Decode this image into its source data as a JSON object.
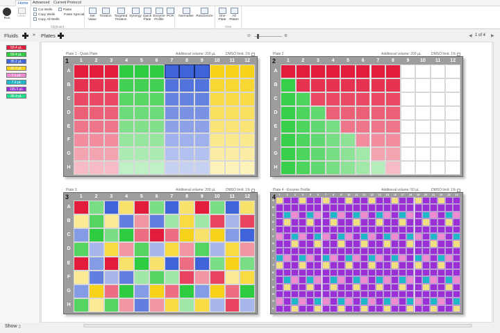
{
  "tabs": [
    "Home",
    "Advanced",
    "Current Protocol"
  ],
  "ribbon": {
    "run": "Run",
    "undo": "Undo",
    "clipboard": {
      "cut": "Cut Wells",
      "copy": "Copy Wells",
      "copy_all": "Copy All Wells",
      "paste": "Paste",
      "paste_special": "Paste Special",
      "label": "Clipboard"
    },
    "tools": [
      "Set Value",
      "Titration",
      "Targeted Titration",
      "Synergy",
      "Quick Plate",
      "Enzyme Profile",
      "PCR",
      "Normalise",
      "Randomize"
    ],
    "view": {
      "one": "One Plate",
      "all": "All Plates",
      "label": "View"
    }
  },
  "fluids": {
    "title": "Fluids",
    "items": [
      {
        "label": "59.4 µL",
        "color": "#e31b3c"
      },
      {
        "label": "59.4 µL",
        "color": "#2ecc40"
      },
      {
        "label": "35.2 µL",
        "color": "#3f63d8"
      },
      {
        "label": "31.2 µL",
        "color": "#f6d21a"
      },
      {
        "label": "7.1 µL",
        "color": "#f08bd0"
      },
      {
        "label": "7.3 µL",
        "color": "#1fb8c8"
      },
      {
        "label": "195.3 µL",
        "color": "#9a2fd6"
      },
      {
        "label": "35.9 µL",
        "color": "#1fe08c"
      }
    ]
  },
  "plates_header": {
    "title": "Plates",
    "page": "1 of 4"
  },
  "show": "Show",
  "rows8": [
    "A",
    "B",
    "C",
    "D",
    "E",
    "F",
    "G",
    "H"
  ],
  "cols12": [
    "1",
    "2",
    "3",
    "4",
    "5",
    "6",
    "7",
    "8",
    "9",
    "10",
    "11",
    "12"
  ],
  "plates": [
    {
      "num": "1",
      "title": "Plate 1 - Quick Plate",
      "volume": "Additional volume: 200 µL",
      "dmso": "DMSO limit: 1%"
    },
    {
      "num": "2",
      "title": "Plate 2",
      "volume": "Additional volume: 200 µL",
      "dmso": "DMSO limit: 1%"
    },
    {
      "num": "3",
      "title": "Plate 3",
      "volume": "Additional volume: 200 µL",
      "dmso": "DMSO limit: 1%"
    },
    {
      "num": "4",
      "title": "Plate 4 - Enzyme Profile",
      "volume": "Additional volume: 50 µL",
      "dmso": "DMSO limit: 1%"
    }
  ],
  "colors": {
    "red": "#e31b3c",
    "green": "#2ecc40",
    "blue": "#3f63d8",
    "yellow": "#f6d21a",
    "purple": "#9a2fd6",
    "plate": "#9d9d9d"
  }
}
